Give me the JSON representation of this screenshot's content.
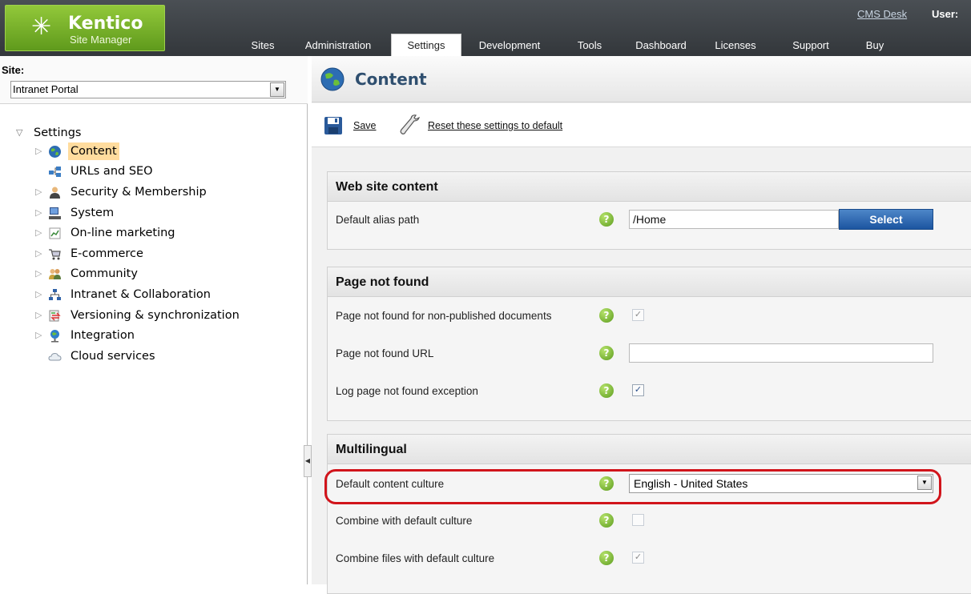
{
  "header": {
    "logo_brand": "Kentico",
    "logo_sub": "Site Manager",
    "tabs": [
      "Sites",
      "Administration",
      "Settings",
      "Development",
      "Tools",
      "Dashboard",
      "Licenses",
      "Support",
      "Buy"
    ],
    "active_tab": "Settings",
    "cms_desk_link": "CMS Desk",
    "user_label": "User:"
  },
  "left": {
    "site_label": "Site:",
    "site_value": "Intranet Portal",
    "tree": {
      "root": "Settings",
      "items": [
        {
          "label": "Content",
          "icon": "globe-icon",
          "selected": true
        },
        {
          "label": "URLs and SEO",
          "icon": "sitemap-icon"
        },
        {
          "label": "Security & Membership",
          "icon": "user-icon"
        },
        {
          "label": "System",
          "icon": "computer-icon"
        },
        {
          "label": "On-line marketing",
          "icon": "chart-icon"
        },
        {
          "label": "E-commerce",
          "icon": "cart-icon"
        },
        {
          "label": "Community",
          "icon": "people-icon"
        },
        {
          "label": "Intranet & Collaboration",
          "icon": "network-icon"
        },
        {
          "label": "Versioning & synchronization",
          "icon": "sync-icon"
        },
        {
          "label": "Integration",
          "icon": "integration-icon"
        },
        {
          "label": "Cloud services",
          "icon": "cloud-icon"
        }
      ]
    }
  },
  "main": {
    "title": "Content",
    "actions": {
      "save": "Save",
      "reset": "Reset these settings to default"
    },
    "sections": [
      {
        "heading": "Web site content",
        "rows": [
          {
            "label": "Default alias path",
            "value": "/Home",
            "button": "Select"
          }
        ]
      },
      {
        "heading": "Page not found",
        "rows": [
          {
            "label": "Page not found for non-published documents",
            "checked": true,
            "disabled": true
          },
          {
            "label": "Page not found URL",
            "value": ""
          },
          {
            "label": "Log page not found exception",
            "checked": true
          }
        ]
      },
      {
        "heading": "Multilingual",
        "rows": [
          {
            "label": "Default content culture",
            "value": "English - United States"
          },
          {
            "label": "Combine with default culture",
            "checked": false,
            "disabled": true
          },
          {
            "label": "Combine files with default culture",
            "checked": true,
            "disabled": true
          }
        ]
      }
    ],
    "help_glyph": "?"
  },
  "colors": {
    "header_bg": "#3b3f43",
    "logo_green": "#7ab52c",
    "selected_bg": "#ffdc9e",
    "select_button": "#2a63ad",
    "highlight_red": "#d1141b"
  }
}
